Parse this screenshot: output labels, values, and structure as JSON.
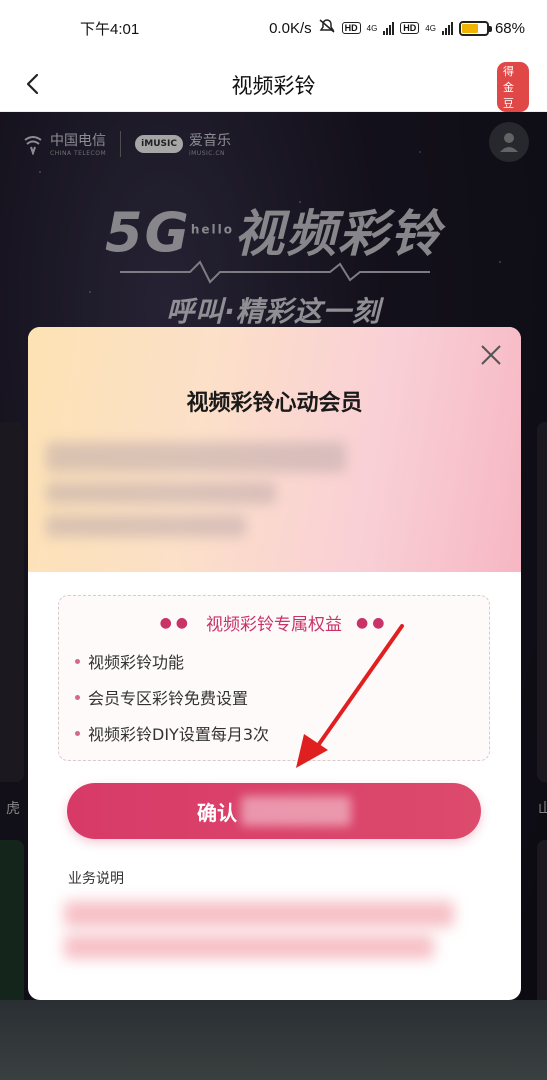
{
  "status_bar": {
    "time": "下午4:01",
    "network_speed": "0.0K/s",
    "network_type_1": "4G",
    "network_type_2": "4G",
    "hd_label": "HD",
    "battery_level": 68,
    "battery_text": "68%"
  },
  "nav": {
    "title": "视频彩铃",
    "badge": "得金豆"
  },
  "banner": {
    "telecom_name": "中国电信",
    "telecom_sub": "CHINA TELECOM",
    "imusic_logo": "iMUSIC",
    "imusic_name": "爱音乐",
    "imusic_sub": "iMUSIC.CN",
    "hero_5g": "5G",
    "hero_hello": "hello",
    "hero_title": "视频彩铃",
    "slogan": "呼叫·精彩这一刻"
  },
  "background": {
    "side_label_left": "虎",
    "side_label_right": "山"
  },
  "modal": {
    "title": "视频彩铃心动会员",
    "benefit_heading": "视频彩铃专属权益",
    "benefits": [
      "视频彩铃功能",
      "会员专区彩铃免费设置",
      "视频彩铃DIY设置每月3次"
    ],
    "confirm_label": "确认",
    "description_label": "业务说明"
  },
  "colors": {
    "accent": "#d83a68",
    "benefit_text": "#c8336a",
    "badge": "#e04848"
  }
}
